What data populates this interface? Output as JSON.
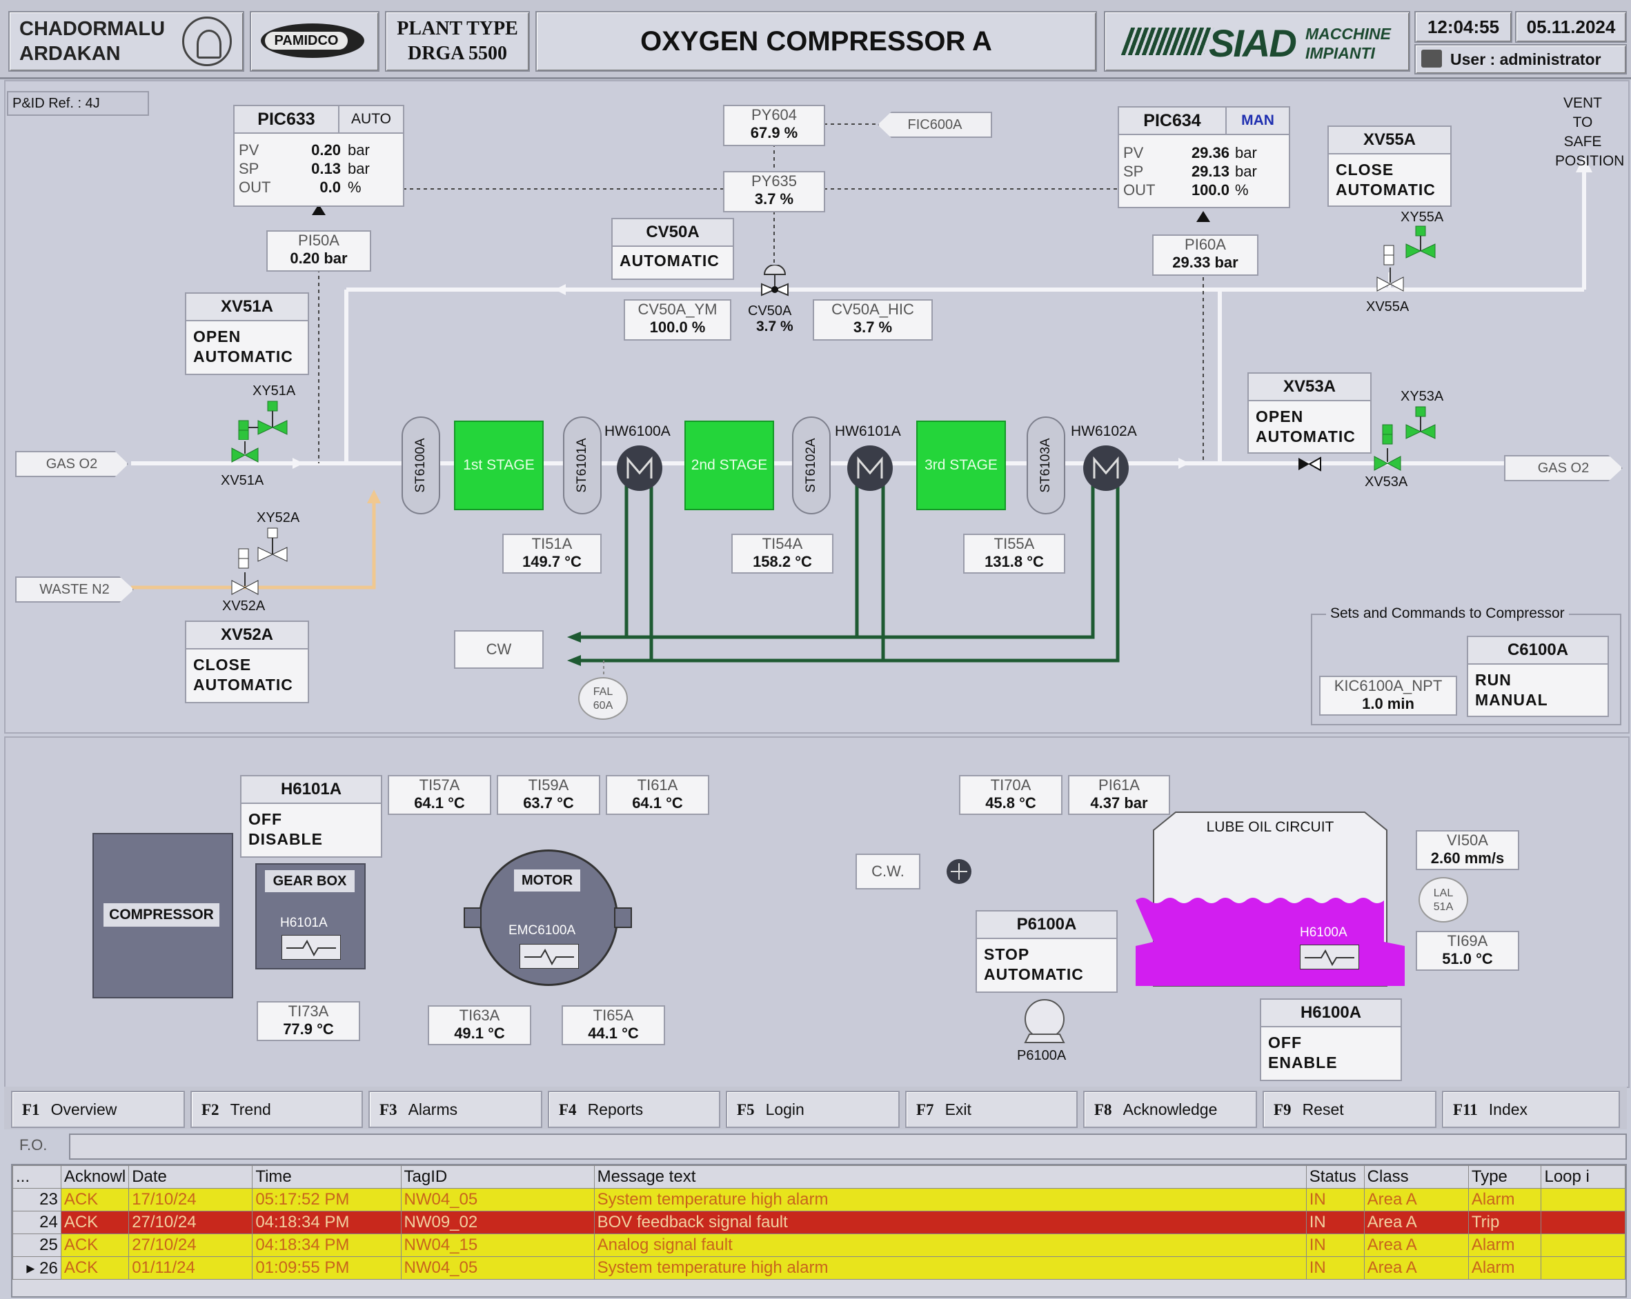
{
  "header": {
    "site_line1": "CHADORMALU",
    "site_line2": "ARDAKAN",
    "pamidco_logo": "PAMIDCO",
    "plant_type_line1": "PLANT TYPE",
    "plant_type_line2": "DRGA 5500",
    "title": "OXYGEN COMPRESSOR A",
    "siad_logo": "SIAD",
    "siad_sub1": "MACCHINE",
    "siad_sub2": "IMPIANTI",
    "time": "12:04:55",
    "date": "05.11.2024",
    "user": "User : administrator"
  },
  "pid_ref": "P&ID Ref. :  4J",
  "pic633": {
    "name": "PIC633",
    "mode": "AUTO",
    "pv_label": "PV",
    "pv": "0.20",
    "pv_unit": "bar",
    "sp_label": "SP",
    "sp": "0.13",
    "sp_unit": "bar",
    "out_label": "OUT",
    "out": "0.0",
    "out_unit": "%"
  },
  "pic634": {
    "name": "PIC634",
    "mode": "MAN",
    "pv_label": "PV",
    "pv": "29.36",
    "pv_unit": "bar",
    "sp_label": "SP",
    "sp": "29.13",
    "sp_unit": "bar",
    "out_label": "OUT",
    "out": "100.0",
    "out_unit": "%"
  },
  "py604": {
    "name": "PY604",
    "value": "67.9 %"
  },
  "py635": {
    "name": "PY635",
    "value": "3.7 %"
  },
  "fic600a": "FIC600A",
  "pi50a": {
    "name": "PI50A",
    "value": "0.20 bar"
  },
  "pi60a": {
    "name": "PI60A",
    "value": "29.33 bar"
  },
  "cv50a": {
    "name": "CV50A",
    "state": "AUTOMATIC",
    "valve_label": "CV50A",
    "valve_value": "3.7 %"
  },
  "cv50a_ym": {
    "name": "CV50A_YM",
    "value": "100.0  %"
  },
  "cv50a_hic": {
    "name": "CV50A_HIC",
    "value": "3.7  %"
  },
  "xv51a": {
    "name": "XV51A",
    "state1": "OPEN",
    "state2": "AUTOMATIC",
    "sol_label": "XY51A",
    "valve_label": "XV51A"
  },
  "xv52a": {
    "name": "XV52A",
    "state1": "CLOSE",
    "state2": "AUTOMATIC",
    "sol_label": "XY52A",
    "valve_label": "XV52A"
  },
  "xv53a": {
    "name": "XV53A",
    "state1": "OPEN",
    "state2": "AUTOMATIC",
    "sol_label": "XY53A",
    "valve_label": "XV53A"
  },
  "xv55a": {
    "name": "XV55A",
    "state1": "CLOSE",
    "state2": "AUTOMATIC",
    "sol_label": "XY55A",
    "valve_label": "XV55A"
  },
  "vent": {
    "line1": "VENT",
    "line2": "TO SAFE",
    "line3": "POSITION"
  },
  "gas_o2_in": "GAS O2",
  "gas_o2_out": "GAS O2",
  "waste_n2": "WASTE N2",
  "strainers": [
    "ST6100A",
    "ST6101A",
    "ST6102A",
    "ST6103A"
  ],
  "stages": [
    "1st STAGE",
    "2nd STAGE",
    "3rd STAGE"
  ],
  "coolers": [
    "HW6100A",
    "HW6101A",
    "HW6102A"
  ],
  "ti51a": {
    "name": "TI51A",
    "value": "149.7 °C"
  },
  "ti54a": {
    "name": "TI54A",
    "value": "158.2 °C"
  },
  "ti55a": {
    "name": "TI55A",
    "value": "131.8 °C"
  },
  "cw": "CW",
  "fal60a": {
    "line1": "FAL",
    "line2": "60A"
  },
  "sets": {
    "group_title": "Sets  and Commands to Compressor",
    "kic_name": "KIC6100A_NPT",
    "kic_value": "1.0  min",
    "c6100a_name": "C6100A",
    "c6100a_state1": "RUN",
    "c6100a_state2": "MANUAL"
  },
  "h6101a_panel": {
    "name": "H6101A",
    "state1": "OFF",
    "state2": "DISABLE"
  },
  "ti57a": {
    "name": "TI57A",
    "value": "64.1 °C"
  },
  "ti59a": {
    "name": "TI59A",
    "value": "63.7 °C"
  },
  "ti61a": {
    "name": "TI61A",
    "value": "64.1 °C"
  },
  "compressor_label": "COMPRESSOR",
  "gearbox": {
    "title": "GEAR BOX",
    "heater": "H6101A"
  },
  "motor": {
    "title": "MOTOR",
    "heater": "EMC6100A"
  },
  "ti73a": {
    "name": "TI73A",
    "value": "77.9 °C"
  },
  "ti63a": {
    "name": "TI63A",
    "value": "49.1 °C"
  },
  "ti65a": {
    "name": "TI65A",
    "value": "44.1 °C"
  },
  "ti70a": {
    "name": "TI70A",
    "value": "45.8 °C"
  },
  "pi61a": {
    "name": "PI61A",
    "value": "4.37 bar"
  },
  "lube": {
    "title": "LUBE OIL CIRCUIT",
    "heater": "H6100A",
    "cw": "C.W.",
    "pump_label": "P6100A"
  },
  "vi50a": {
    "name": "VI50A",
    "value": "2.60 mm/s"
  },
  "lal51a": {
    "line1": "LAL",
    "line2": "51A"
  },
  "ti69a": {
    "name": "TI69A",
    "value": "51.0 °C"
  },
  "p6100a": {
    "name": "P6100A",
    "state1": "STOP",
    "state2": "AUTOMATIC"
  },
  "h6100a_panel": {
    "name": "H6100A",
    "state1": "OFF",
    "state2": "ENABLE"
  },
  "fkeys": [
    {
      "key": "F1",
      "label": "Overview"
    },
    {
      "key": "F2",
      "label": "Trend"
    },
    {
      "key": "F3",
      "label": "Alarms"
    },
    {
      "key": "F4",
      "label": "Reports"
    },
    {
      "key": "F5",
      "label": "Login"
    },
    {
      "key": "F7",
      "label": "Exit"
    },
    {
      "key": "F8",
      "label": "Acknowledge"
    },
    {
      "key": "F9",
      "label": "Reset"
    },
    {
      "key": "F11",
      "label": "Index"
    }
  ],
  "fo_label": "F.O.",
  "alarm_table": {
    "headers": [
      "...",
      "Acknowl",
      "Date",
      "Time",
      "TagID",
      "Message text",
      "Status",
      "Class",
      "Type",
      "Loop i"
    ],
    "rows": [
      {
        "n": "23",
        "ack": "ACK",
        "date": "17/10/24",
        "time": "05:17:52 PM",
        "tag": "NW04_05",
        "msg": "System temperature high alarm",
        "status": "IN",
        "class": "Area A",
        "type": "Alarm",
        "color": "#e8e41c"
      },
      {
        "n": "24",
        "ack": "ACK",
        "date": "27/10/24",
        "time": "04:18:34 PM",
        "tag": "NW09_02",
        "msg": "BOV feedback signal fault",
        "status": "IN",
        "class": "Area A",
        "type": "Trip",
        "color": "#c8281c"
      },
      {
        "n": "25",
        "ack": "ACK",
        "date": "27/10/24",
        "time": "04:18:34 PM",
        "tag": "NW04_15",
        "msg": "Analog signal fault",
        "status": "IN",
        "class": "Area A",
        "type": "Alarm",
        "color": "#e8e41c"
      },
      {
        "n": "▸ 26",
        "ack": "ACK",
        "date": "01/11/24",
        "time": "01:09:55 PM",
        "tag": "NW04_05",
        "msg": "System temperature high alarm",
        "status": "IN",
        "class": "Area A",
        "type": "Alarm",
        "color": "#e8e41c"
      }
    ]
  },
  "colors": {
    "stage_green": "#24d53a",
    "valve_green": "#2ec43c",
    "lube_magenta": "#d21ef0",
    "pipe_white": "#f4f4f8",
    "pipe_orange": "#f0c890",
    "pipe_cw": "#1e5a32",
    "alarm_yellow": "#e8e41c",
    "alarm_red": "#c8281c"
  }
}
